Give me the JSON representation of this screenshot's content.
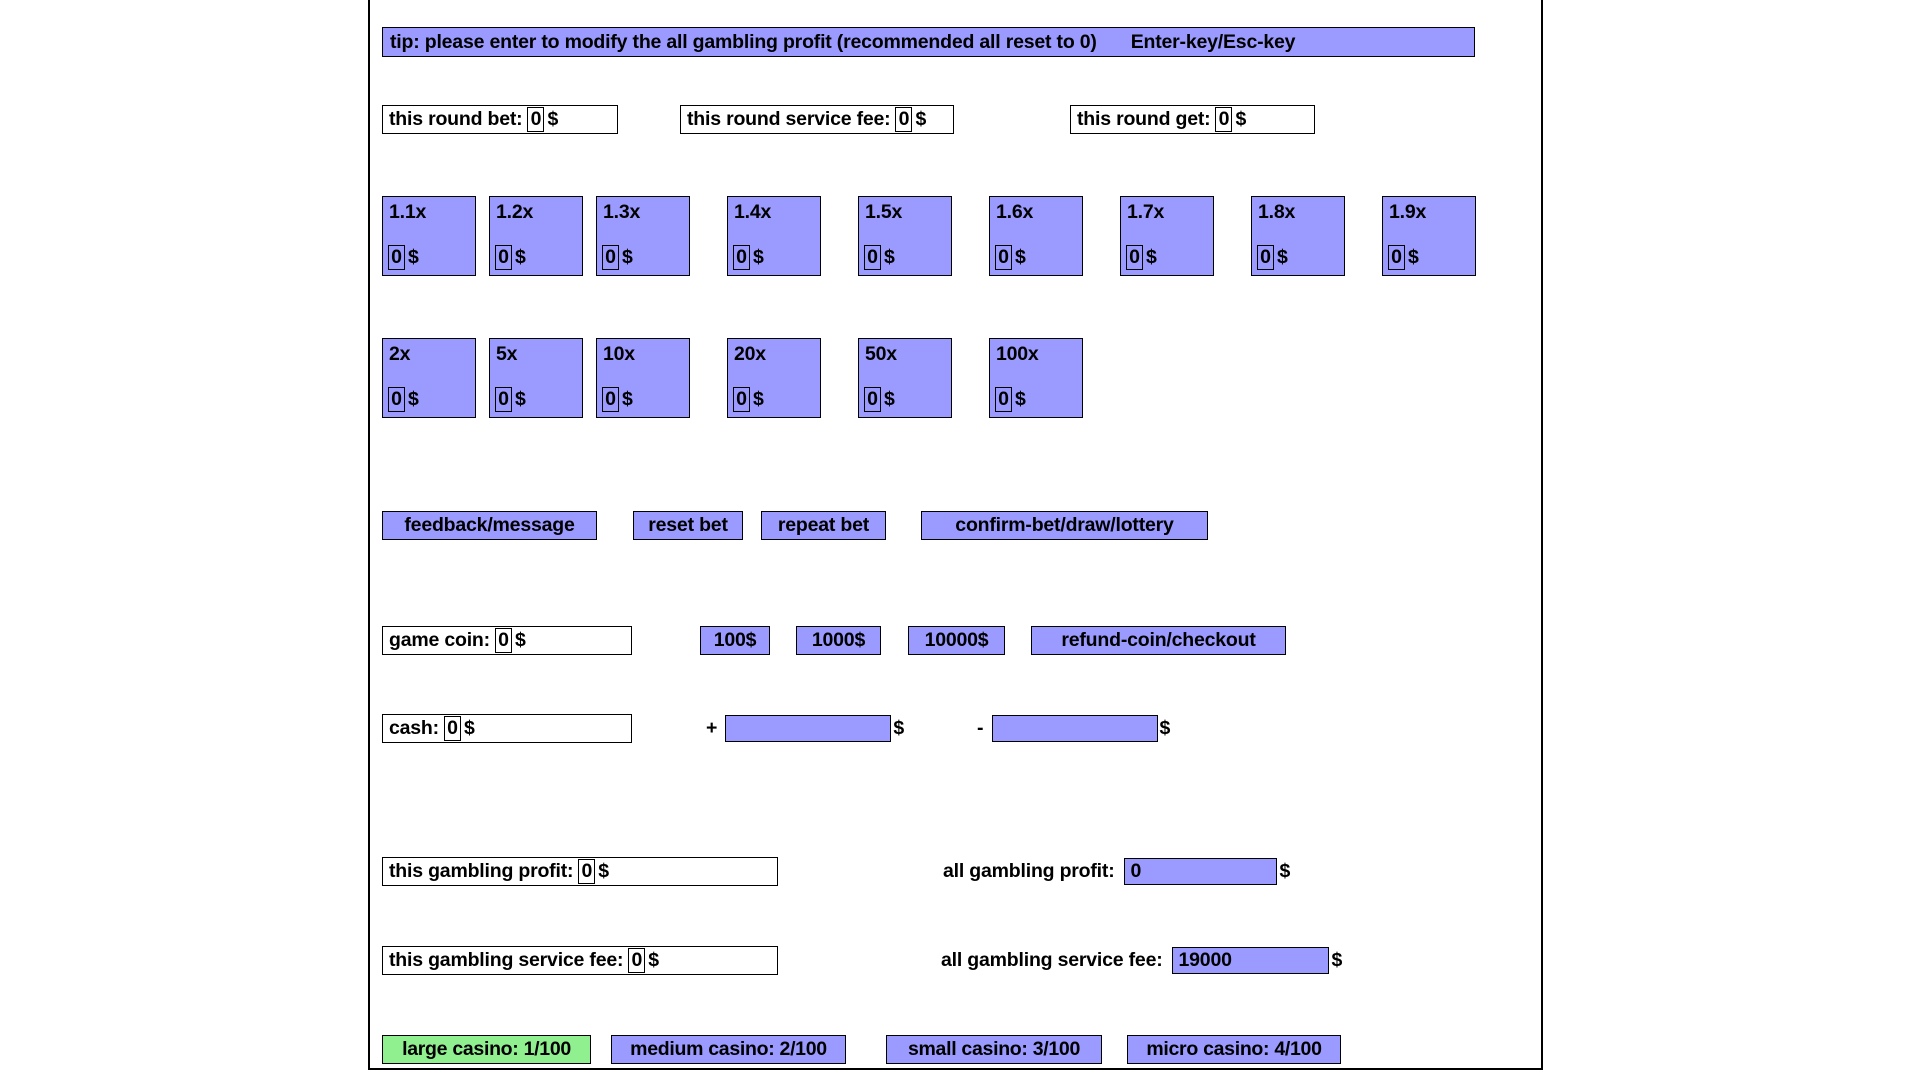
{
  "tip": {
    "text": "tip: please enter to modify the all gambling profit (recommended all reset to 0)",
    "keys": "Enter-key/Esc-key"
  },
  "round": {
    "bet": {
      "label": "this round bet:",
      "value": "0",
      "unit": "$"
    },
    "service_fee": {
      "label": "this round service fee:",
      "value": "0",
      "unit": "$"
    },
    "get": {
      "label": "this round get:",
      "value": "0",
      "unit": "$"
    }
  },
  "multipliers_row1": [
    {
      "label": "1.1x",
      "value": "0",
      "unit": "$"
    },
    {
      "label": "1.2x",
      "value": "0",
      "unit": "$"
    },
    {
      "label": "1.3x",
      "value": "0",
      "unit": "$"
    },
    {
      "label": "1.4x",
      "value": "0",
      "unit": "$"
    },
    {
      "label": "1.5x",
      "value": "0",
      "unit": "$"
    },
    {
      "label": "1.6x",
      "value": "0",
      "unit": "$"
    },
    {
      "label": "1.7x",
      "value": "0",
      "unit": "$"
    },
    {
      "label": "1.8x",
      "value": "0",
      "unit": "$"
    },
    {
      "label": "1.9x",
      "value": "0",
      "unit": "$"
    }
  ],
  "multipliers_row2": [
    {
      "label": "2x",
      "value": "0",
      "unit": "$"
    },
    {
      "label": "5x",
      "value": "0",
      "unit": "$"
    },
    {
      "label": "10x",
      "value": "0",
      "unit": "$"
    },
    {
      "label": "20x",
      "value": "0",
      "unit": "$"
    },
    {
      "label": "50x",
      "value": "0",
      "unit": "$"
    },
    {
      "label": "100x",
      "value": "0",
      "unit": "$"
    }
  ],
  "actions": {
    "feedback": "feedback/message",
    "reset_bet": "reset bet",
    "repeat_bet": "repeat bet",
    "confirm_bet": "confirm-bet/draw/lottery"
  },
  "coin": {
    "label": "game coin:",
    "value": "0",
    "unit": "$",
    "denominations": [
      "100$",
      "1000$",
      "10000$"
    ],
    "refund": "refund-coin/checkout"
  },
  "cash": {
    "label": "cash:",
    "value": "0",
    "unit": "$",
    "add_sign": "+",
    "add_value": "",
    "add_unit": "$",
    "sub_sign": "-",
    "sub_value": "",
    "sub_unit": "$"
  },
  "profit": {
    "this_label": "this gambling profit:",
    "this_value": "0",
    "this_unit": "$",
    "all_label": "all gambling profit:",
    "all_value": "0",
    "all_unit": "$"
  },
  "service_fee": {
    "this_label": "this gambling service fee:",
    "this_value": "0",
    "this_unit": "$",
    "all_label": "all gambling service fee:",
    "all_value": "19000",
    "all_unit": "$"
  },
  "casinos": [
    {
      "label": "large casino: 1/100",
      "active": true
    },
    {
      "label": "medium casino: 2/100",
      "active": false
    },
    {
      "label": "small casino: 3/100",
      "active": false
    },
    {
      "label": "micro casino: 4/100",
      "active": false
    }
  ],
  "colors": {
    "purple": "#9a9aff",
    "green": "#90f090",
    "border": "#000000",
    "background": "#ffffff"
  }
}
